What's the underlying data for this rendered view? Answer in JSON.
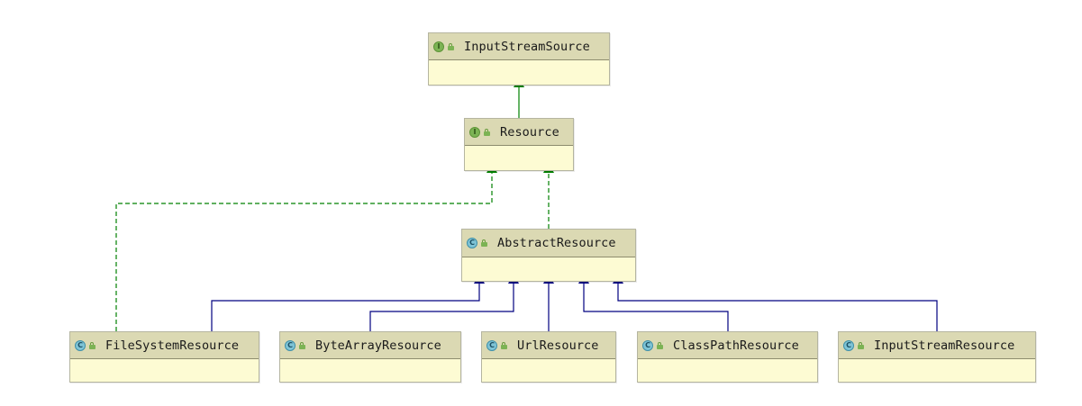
{
  "diagram": {
    "nodes": [
      {
        "id": "input-stream-source",
        "label": "InputStreamSource",
        "kind": "interface",
        "icon": "interface-icon"
      },
      {
        "id": "resource",
        "label": "Resource",
        "kind": "interface",
        "icon": "interface-icon"
      },
      {
        "id": "abstract-resource",
        "label": "AbstractResource",
        "kind": "class",
        "icon": "class-icon"
      },
      {
        "id": "file-system-resource",
        "label": "FileSystemResource",
        "kind": "class",
        "icon": "class-icon"
      },
      {
        "id": "byte-array-resource",
        "label": "ByteArrayResource",
        "kind": "class",
        "icon": "class-icon"
      },
      {
        "id": "url-resource",
        "label": "UrlResource",
        "kind": "class",
        "icon": "class-icon"
      },
      {
        "id": "class-path-resource",
        "label": "ClassPathResource",
        "kind": "class",
        "icon": "class-icon"
      },
      {
        "id": "input-stream-resource",
        "label": "InputStreamResource",
        "kind": "class",
        "icon": "class-icon"
      }
    ],
    "edges": [
      {
        "from": "resource",
        "to": "input-stream-source",
        "relation": "extends"
      },
      {
        "from": "abstract-resource",
        "to": "resource",
        "relation": "implements"
      },
      {
        "from": "file-system-resource",
        "to": "resource",
        "relation": "implements"
      },
      {
        "from": "file-system-resource",
        "to": "abstract-resource",
        "relation": "extends"
      },
      {
        "from": "byte-array-resource",
        "to": "abstract-resource",
        "relation": "extends"
      },
      {
        "from": "url-resource",
        "to": "abstract-resource",
        "relation": "extends"
      },
      {
        "from": "class-path-resource",
        "to": "abstract-resource",
        "relation": "extends"
      },
      {
        "from": "input-stream-resource",
        "to": "abstract-resource",
        "relation": "extends"
      }
    ]
  },
  "colors": {
    "interface_extends": "#008000",
    "implements": "#008000",
    "class_extends": "#000080",
    "box_body": "#fdfbd3",
    "box_header": "#dbd9b3"
  },
  "icon_letters": {
    "interface": "I",
    "class": "C"
  }
}
